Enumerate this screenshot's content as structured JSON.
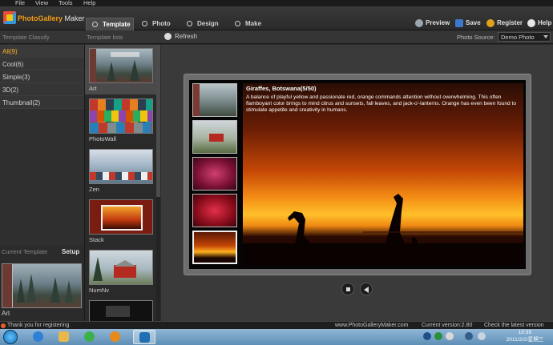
{
  "menubar": {
    "items": [
      "File",
      "View",
      "Tools",
      "Help"
    ]
  },
  "app": {
    "name_part1": "PhotoGallery",
    "name_part2": "Maker"
  },
  "tabs": [
    {
      "label": "Template",
      "icon": "template-icon",
      "active": true
    },
    {
      "label": "Photo",
      "icon": "photo-icon"
    },
    {
      "label": "Design",
      "icon": "design-icon"
    },
    {
      "label": "Make",
      "icon": "make-icon"
    }
  ],
  "header_actions": [
    {
      "label": "Preview",
      "icon": "preview-icon",
      "color": "#9aa7b0"
    },
    {
      "label": "Save",
      "icon": "save-icon",
      "color": "#3b78c8"
    },
    {
      "label": "Register",
      "icon": "register-icon",
      "color": "#e0a21a"
    },
    {
      "label": "Help",
      "icon": "help-icon",
      "color": "#e8e8e8"
    }
  ],
  "subbar": {
    "template_classify": "Template Classify",
    "template_lists": "Template lists",
    "refresh": "Refresh",
    "photo_source_label": "Photo Source:",
    "photo_source_value": "Demo Photo"
  },
  "categories": [
    {
      "label": "All(9)",
      "active": true
    },
    {
      "label": "Cool(6)"
    },
    {
      "label": "Simple(3)"
    },
    {
      "label": "3D(2)"
    },
    {
      "label": "Thumbnail(2)"
    }
  ],
  "current_template": {
    "label": "Current Template",
    "setup": "Setup",
    "name": "Art"
  },
  "templates": [
    {
      "name": "Art",
      "selected": true
    },
    {
      "name": "PhotoWall"
    },
    {
      "name": "Zen"
    },
    {
      "name": "Stack"
    },
    {
      "name": "NumNv"
    },
    {
      "name": ""
    }
  ],
  "preview": {
    "caption_title": "Giraffes, Botswana(5/50)",
    "caption_body": "A balance of playful yellow and passionate red, orange commands attention without overwhelming. This often flamboyant color brings to mind citrus and sunsets, fall leaves, and jack-o'-lanterns. Orange has even been found to stimulate appetite and creativity in humans."
  },
  "status": {
    "message": "Thank you for registering",
    "site": "www.PhotoGalleryMaker.com",
    "version": "Current version:2.80",
    "check": "Check the latest version"
  },
  "taskbar": {
    "time": "10:35",
    "date": "2011/2/2/星期三"
  }
}
